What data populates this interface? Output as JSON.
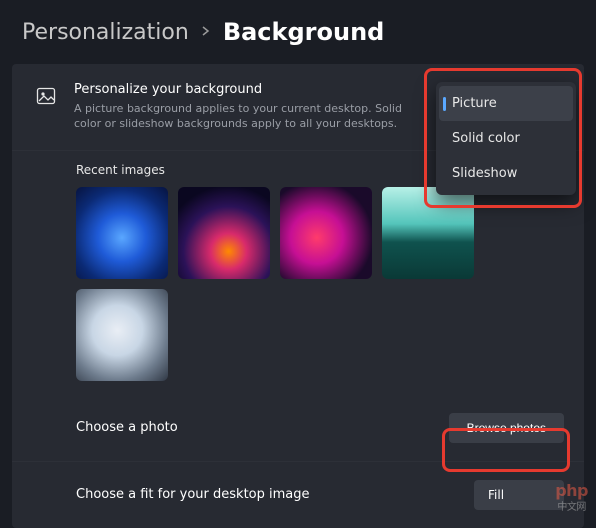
{
  "breadcrumb": {
    "parent": "Personalization",
    "current": "Background"
  },
  "personalize": {
    "title": "Personalize your background",
    "description": "A picture background applies to your current desktop. Solid color or slideshow backgrounds apply to all your desktops."
  },
  "dropdown": {
    "options": [
      "Picture",
      "Solid color",
      "Slideshow"
    ],
    "selected": "Picture"
  },
  "recent": {
    "label": "Recent images",
    "thumbs": [
      "windows-bloom",
      "eclipse-arc",
      "abstract-swirl",
      "lake-horizon",
      "silver-petals"
    ]
  },
  "choose_photo": {
    "label": "Choose a photo",
    "button": "Browse photos"
  },
  "choose_fit": {
    "label": "Choose a fit for your desktop image",
    "value": "Fill"
  },
  "watermark": {
    "text": "php",
    "sub": "中文网"
  },
  "highlight_color": "#e63a2f"
}
